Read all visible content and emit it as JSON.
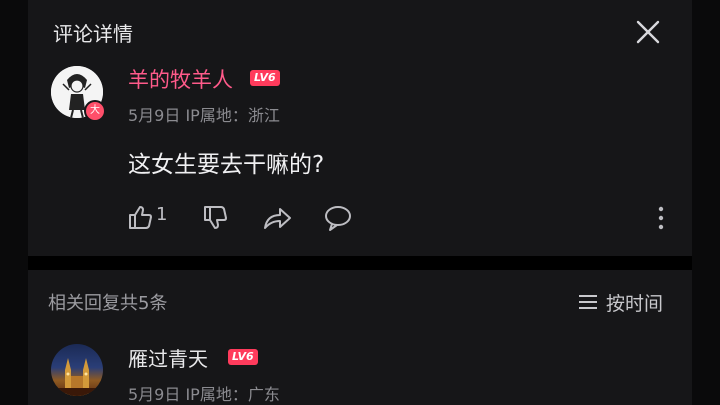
{
  "header": {
    "title": "评论详情"
  },
  "comment": {
    "username": "羊的牧羊人",
    "level": "LV6",
    "avatar_badge": "大",
    "meta": "5月9日 IP属地：浙江",
    "text": "这女生要去干嘛的?",
    "like_count": "1"
  },
  "replies": {
    "header": "相关回复共5条",
    "sort_label": "按时间"
  },
  "reply1": {
    "username": "雁过青天",
    "level": "LV6",
    "meta": "5月9日 IP属地：广东"
  },
  "colors": {
    "background": "#000000",
    "panel": "#161618",
    "username_accent": "#ff5a8a",
    "level_badge": "#ff3b5c"
  },
  "icons": [
    "close-icon",
    "thumbs-up-icon",
    "thumbs-down-icon",
    "share-icon",
    "comment-icon",
    "more-vertical-icon",
    "sort-list-icon"
  ]
}
